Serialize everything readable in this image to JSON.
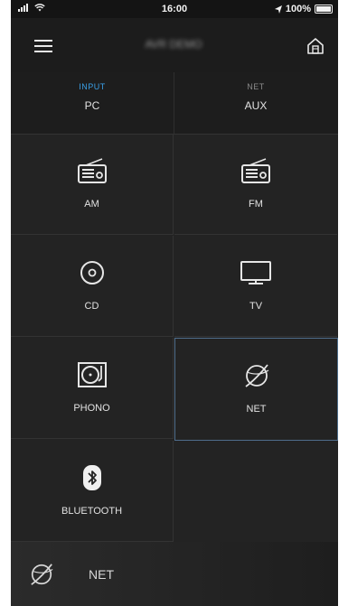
{
  "status_bar": {
    "time": "16:00",
    "battery": "100%"
  },
  "header": {
    "title": "AVR DEMO"
  },
  "tabs": [
    {
      "category": "INPUT",
      "name": "PC",
      "category_color": "#3aa0e8"
    },
    {
      "category": "NET",
      "name": "AUX",
      "category_color": "#8a8a8a"
    }
  ],
  "sources": [
    {
      "label": "AM",
      "icon": "radio-icon"
    },
    {
      "label": "FM",
      "icon": "radio-icon"
    },
    {
      "label": "CD",
      "icon": "disc-icon"
    },
    {
      "label": "TV",
      "icon": "tv-icon"
    },
    {
      "label": "PHONO",
      "icon": "turntable-icon"
    },
    {
      "label": "NET",
      "icon": "globe-icon",
      "selected": true
    },
    {
      "label": "BLUETOOTH",
      "icon": "bluetooth-icon"
    }
  ],
  "now_playing": {
    "label": "NET",
    "icon": "globe-icon"
  },
  "colors": {
    "background": "#232323",
    "accent": "#3aa0e8",
    "selected_border": "#4e6d8b"
  }
}
